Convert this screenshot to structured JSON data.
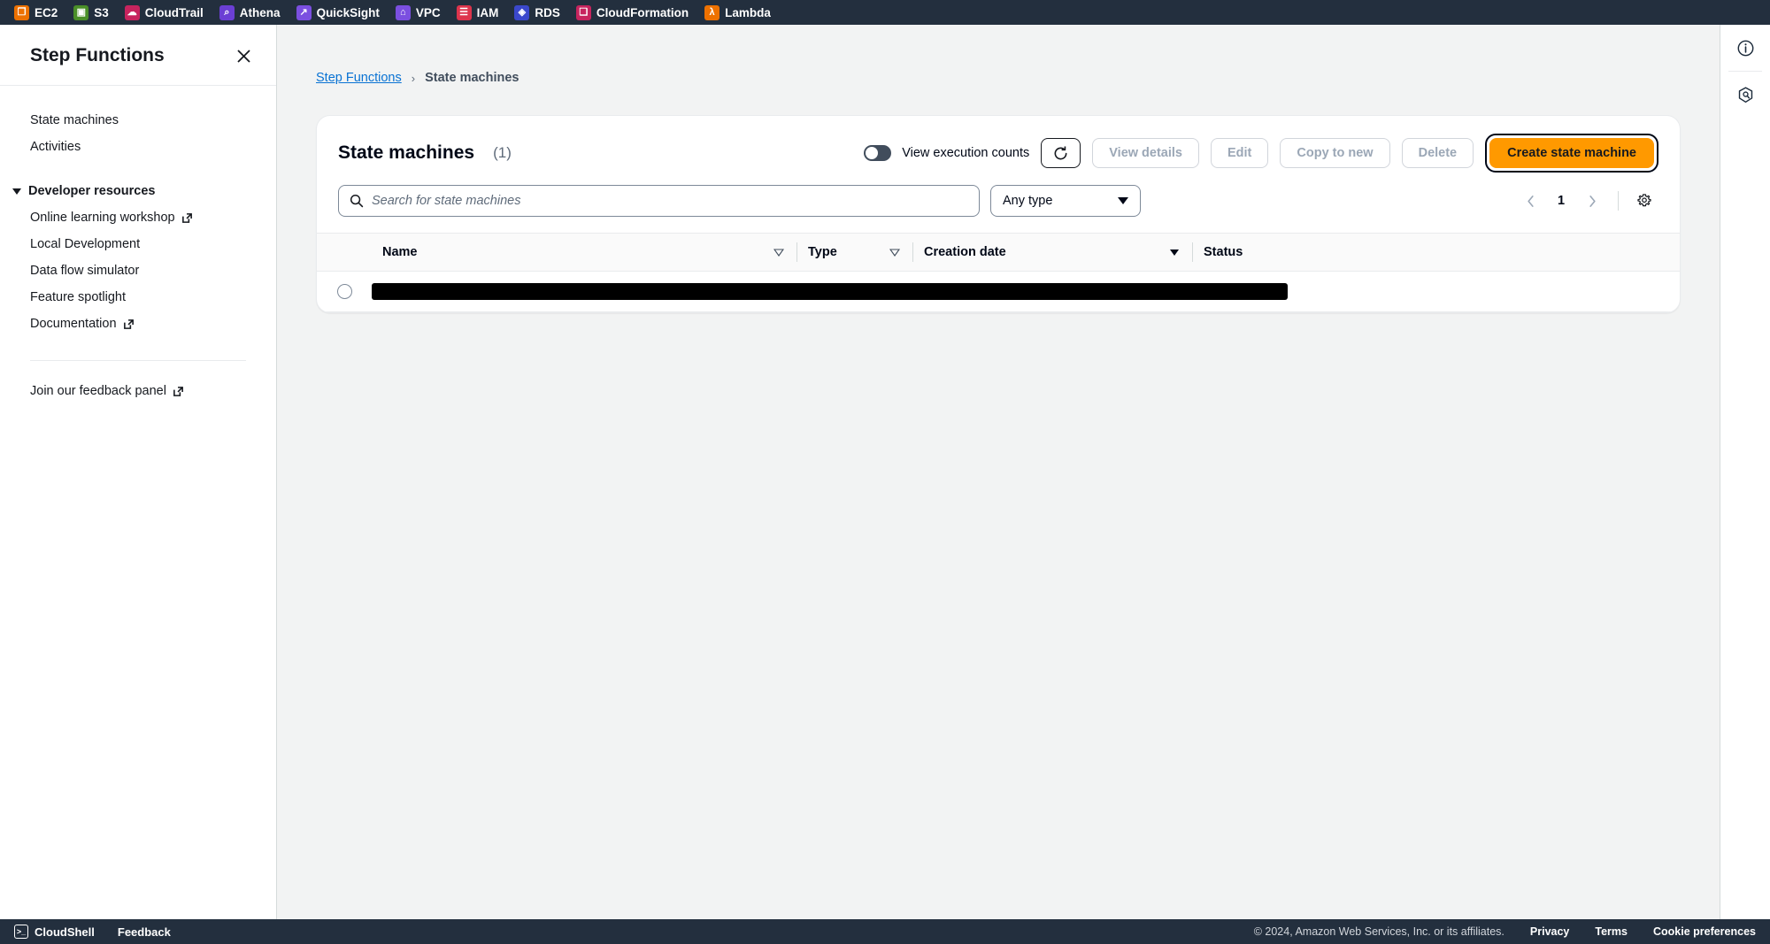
{
  "topnav": {
    "items": [
      {
        "label": "EC2",
        "icon": "ec2-icon",
        "color": "#ed7100",
        "glyph": "❐"
      },
      {
        "label": "S3",
        "icon": "s3-icon",
        "color": "#4a8f28",
        "glyph": "▣"
      },
      {
        "label": "CloudTrail",
        "icon": "cloudtrail-icon",
        "color": "#c7245e",
        "glyph": "☁"
      },
      {
        "label": "Athena",
        "icon": "athena-icon",
        "color": "#6b3fd4",
        "glyph": "⌕"
      },
      {
        "label": "QuickSight",
        "icon": "quicksight-icon",
        "color": "#7b4fe0",
        "glyph": "↗"
      },
      {
        "label": "VPC",
        "icon": "vpc-icon",
        "color": "#7b4fe0",
        "glyph": "⌂"
      },
      {
        "label": "IAM",
        "icon": "iam-icon",
        "color": "#dd344c",
        "glyph": "☰"
      },
      {
        "label": "RDS",
        "icon": "rds-icon",
        "color": "#3b48cc",
        "glyph": "◈"
      },
      {
        "label": "CloudFormation",
        "icon": "cloudformation-icon",
        "color": "#c7245e",
        "glyph": "❑"
      },
      {
        "label": "Lambda",
        "icon": "lambda-icon",
        "color": "#ed7100",
        "glyph": "λ"
      }
    ]
  },
  "sidebar": {
    "title": "Step Functions",
    "close_label": "Close",
    "items": [
      {
        "label": "State machines",
        "external": false
      },
      {
        "label": "Activities",
        "external": false
      }
    ],
    "group": {
      "label": "Developer resources",
      "expanded": true,
      "items": [
        {
          "label": "Online learning workshop",
          "external": true
        },
        {
          "label": "Local Development",
          "external": false
        },
        {
          "label": "Data flow simulator",
          "external": false
        },
        {
          "label": "Feature spotlight",
          "external": false
        },
        {
          "label": "Documentation",
          "external": true
        }
      ]
    },
    "feedback": {
      "label": "Join our feedback panel",
      "external": true
    }
  },
  "breadcrumb": {
    "root": "Step Functions",
    "separator": "›",
    "current": "State machines"
  },
  "panel": {
    "title": "State machines",
    "count": "(1)",
    "toggle": {
      "label": "View execution counts",
      "enabled": false
    },
    "refresh_icon": "refresh-icon",
    "buttons": [
      {
        "label": "View details",
        "disabled": true
      },
      {
        "label": "Edit",
        "disabled": true
      },
      {
        "label": "Copy to new",
        "disabled": true
      },
      {
        "label": "Delete",
        "disabled": true
      }
    ],
    "primary_button": {
      "label": "Create state machine",
      "color": "#ff9900",
      "focused": true
    }
  },
  "filters": {
    "search": {
      "placeholder": "Search for state machines",
      "value": "",
      "icon": "search-icon"
    },
    "type_select": {
      "value": "Any type",
      "icon": "chevron-down-icon"
    },
    "pagination": {
      "prev": "‹",
      "page": "1",
      "next": "›"
    },
    "settings_icon": "gear-icon"
  },
  "table": {
    "columns": [
      {
        "label": "Name",
        "sort": "unsorted"
      },
      {
        "label": "Type",
        "sort": "unsorted"
      },
      {
        "label": "Creation date",
        "sort": "descending"
      },
      {
        "label": "Status",
        "sort": "none"
      }
    ],
    "rows": [
      {
        "selected": false,
        "name": "",
        "redacted": true,
        "type": "",
        "creation_date": "",
        "status": ""
      }
    ]
  },
  "right_rail": {
    "items": [
      {
        "icon": "info-icon",
        "label": "Info panel"
      },
      {
        "icon": "shield-icon",
        "label": "Settings panel"
      }
    ]
  },
  "footer": {
    "cloudshell": {
      "label": "CloudShell",
      "icon": "terminal-icon"
    },
    "feedback": {
      "label": "Feedback"
    },
    "copyright": "© 2024, Amazon Web Services, Inc. or its affiliates.",
    "links": [
      "Privacy",
      "Terms",
      "Cookie preferences"
    ]
  }
}
